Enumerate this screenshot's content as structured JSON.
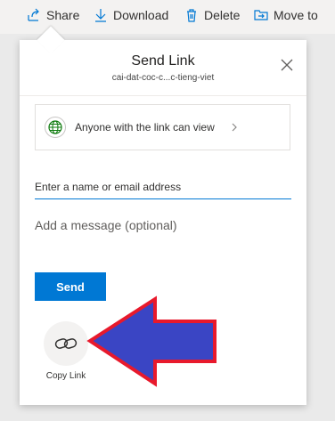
{
  "toolbar": {
    "share": "Share",
    "download": "Download",
    "delete": "Delete",
    "move_to": "Move to"
  },
  "panel": {
    "title": "Send Link",
    "subtitle": "cai-dat-coc-c...c-tieng-viet",
    "link_setting": "Anyone with the link can view",
    "name_placeholder": "Enter a name or email address",
    "message_placeholder": "Add a message (optional)",
    "send_label": "Send",
    "copy_link_label": "Copy Link"
  },
  "colors": {
    "accent": "#0078d4",
    "arrow_fill": "#3a45c4",
    "arrow_stroke": "#e8192c"
  },
  "icons": [
    "share-icon",
    "download-icon",
    "delete-icon",
    "move-to-icon",
    "close-icon",
    "globe-icon",
    "chevron-right-icon",
    "link-icon"
  ]
}
